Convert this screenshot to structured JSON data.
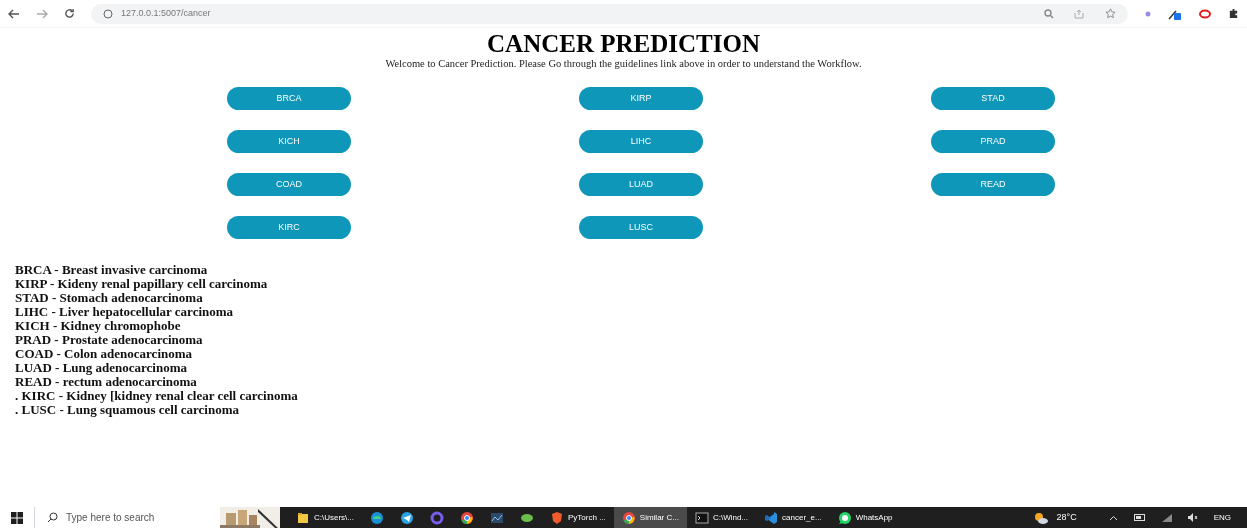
{
  "browser": {
    "url": "127.0.0.1:5007/cancer"
  },
  "page": {
    "title": "CANCER PREDICTION",
    "subtitle": "Welcome to Cancer Prediction. Please Go through the guidelines link above in order to understand the Workflow.",
    "buttons": [
      "BRCA",
      "KIRP",
      "STAD",
      "KICH",
      "LIHC",
      "PRAD",
      "COAD",
      "LUAD",
      "READ",
      "KIRC",
      "LUSC"
    ],
    "legend": [
      "BRCA - Breast invasive carcinoma",
      "KIRP - Kideny renal papillary cell carcinoma",
      "STAD - Stomach adenocarcinoma",
      "LIHC - Liver hepatocellular carcinoma",
      "KICH - Kidney chromophobe",
      "PRAD - Prostate adenocarcinoma",
      "COAD - Colon adenocarcinoma",
      "LUAD - Lung adenocarcinoma",
      "READ - rectum adenocarcinoma",
      ". KIRC - Kidney [kidney renal clear cell carcinoma",
      ". LUSC - Lung squamous cell carcinoma"
    ]
  },
  "taskbar": {
    "search": {
      "placeholder": "Type here to search"
    },
    "apps": [
      {
        "kind": "folder",
        "label": "C:\\Users\\...",
        "selected": false
      },
      {
        "kind": "wave",
        "selected": false
      },
      {
        "kind": "plane",
        "selected": false
      },
      {
        "kind": "ring",
        "selected": false
      },
      {
        "kind": "browser",
        "selected": false
      },
      {
        "kind": "chart",
        "selected": false
      },
      {
        "kind": "leaf",
        "selected": false
      },
      {
        "kind": "shield",
        "label": "PyTorch ...",
        "selected": false
      },
      {
        "kind": "browser",
        "label": "Similar C...",
        "selected": true
      },
      {
        "kind": "terminal",
        "label": "C:\\Wind...",
        "selected": false
      },
      {
        "kind": "code",
        "label": "cancer_e...",
        "selected": false
      },
      {
        "kind": "chat",
        "label": "WhatsApp",
        "selected": false
      }
    ],
    "weather": "28°C",
    "language": "ENG"
  }
}
